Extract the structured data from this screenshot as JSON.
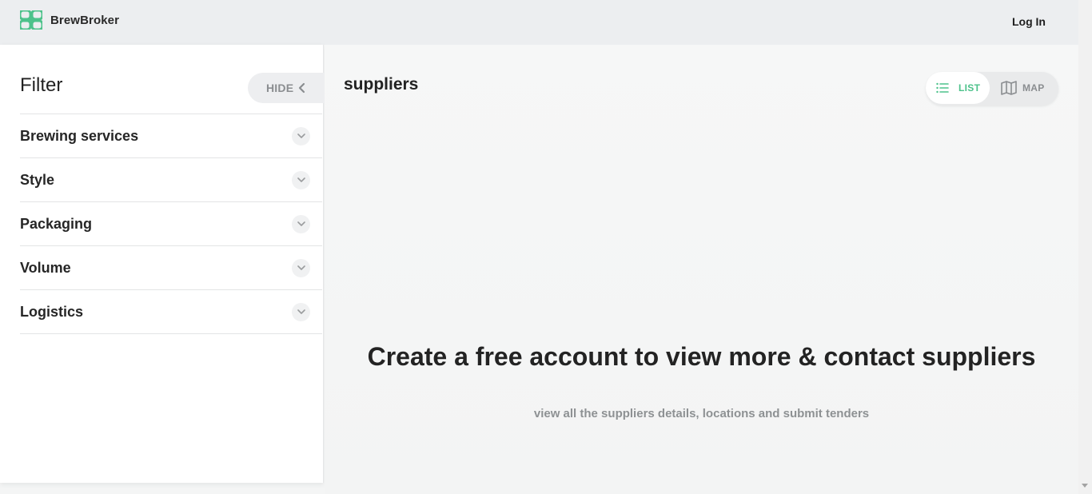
{
  "header": {
    "brand": "BrewBroker",
    "login_label": "Log In"
  },
  "sidebar": {
    "title": "Filter",
    "hide_label": "HIDE",
    "filters": [
      {
        "label": "Brewing services"
      },
      {
        "label": "Style"
      },
      {
        "label": "Packaging"
      },
      {
        "label": "Volume"
      },
      {
        "label": "Logistics"
      }
    ]
  },
  "main": {
    "title": "suppliers",
    "view_toggle": {
      "list_label": "LIST",
      "map_label": "MAP",
      "selected": "list"
    },
    "cta_title": "Create a free account to view more & contact suppliers",
    "cta_subtitle": "view all the suppliers details, locations and submit tenders"
  },
  "colors": {
    "accent": "#4dc28b",
    "header_bg": "#eceef0",
    "muted_text": "#8a8d90"
  }
}
